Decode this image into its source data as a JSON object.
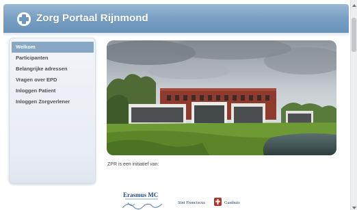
{
  "header": {
    "title": "Zorg Portaal Rijnmond",
    "logo_icon": "medical-cross-icon"
  },
  "sidebar": {
    "items": [
      {
        "label": "Welkom",
        "active": true
      },
      {
        "label": "Participanten",
        "active": false
      },
      {
        "label": "Belangrijke adressen",
        "active": false
      },
      {
        "label": "Vragen over EPD",
        "active": false
      },
      {
        "label": "Inloggen Patient",
        "active": false
      },
      {
        "label": "Inloggen Zorgverlener",
        "active": false
      }
    ]
  },
  "main": {
    "photo_description_icon": "building-photo",
    "intro_text": "ZPR is een initiatief van:",
    "partners": [
      {
        "name": "Erasmus MC"
      },
      {
        "name": "Sint Franciscus Gasthuis"
      }
    ]
  },
  "colors": {
    "header": "#7aa1c4",
    "active_nav": "#88a7c4",
    "erasmus_blue": "#1d4b8f",
    "franciscus_red": "#b5312b"
  }
}
